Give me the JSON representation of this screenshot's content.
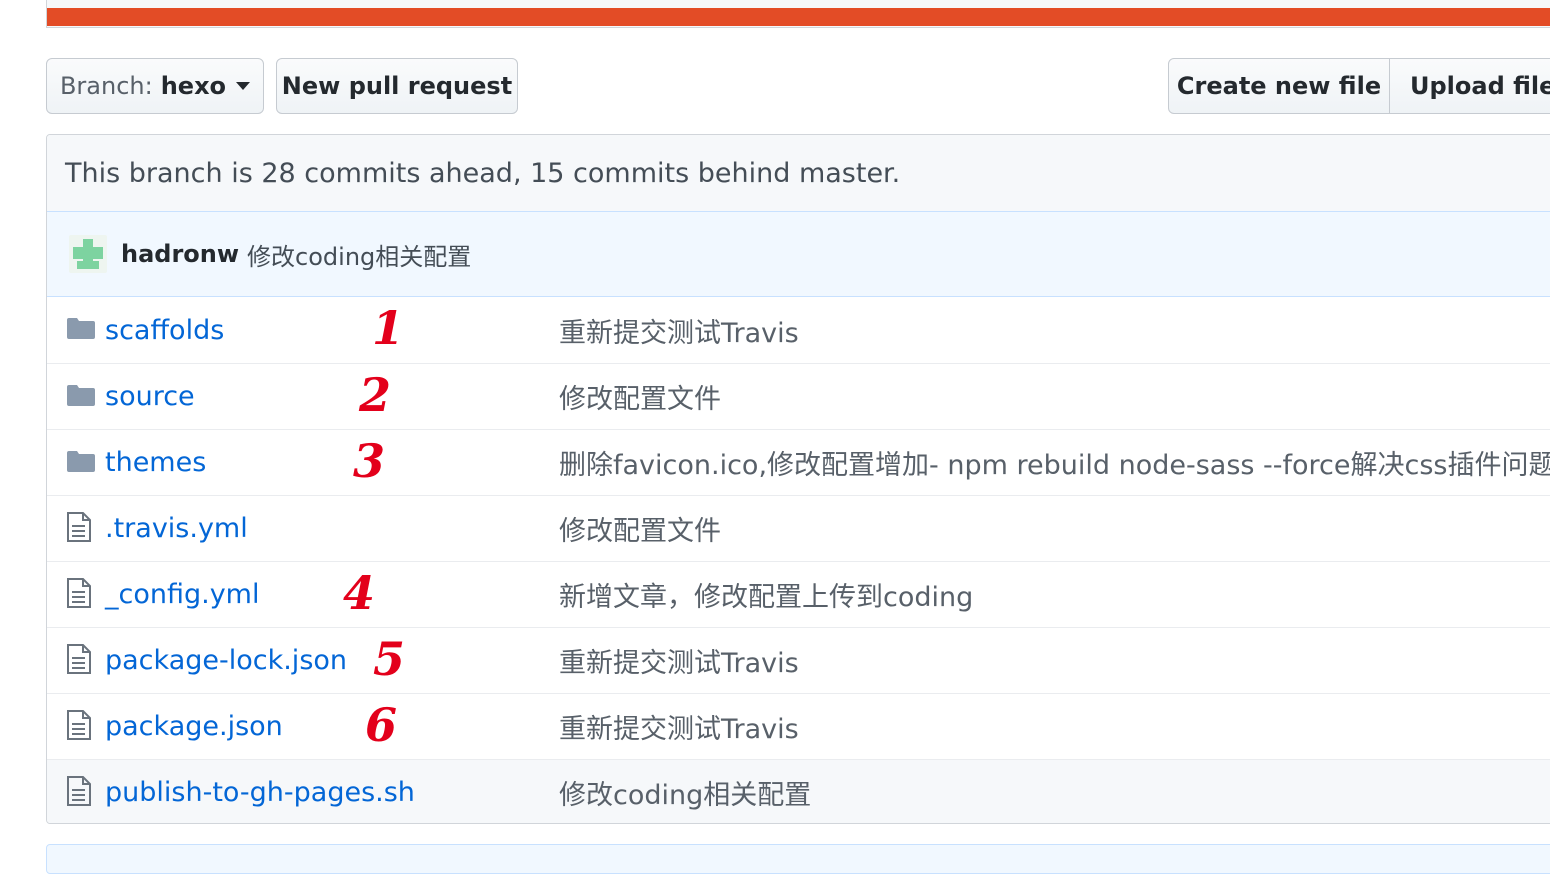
{
  "colors": {
    "language_bar": "#e34c26",
    "link": "#0366d6",
    "annotation": "#e3001b"
  },
  "toolbar": {
    "branch_label": "Branch:",
    "branch_name": "hexo",
    "new_pull_request": "New pull request",
    "create_new_file": "Create new file",
    "upload_files": "Upload files"
  },
  "branch_info": "This branch is 28 commits ahead, 15 commits behind master.",
  "latest_commit": {
    "author": "hadronw",
    "message": "修改coding相关配置"
  },
  "files": [
    {
      "name": "scaffolds",
      "type": "folder",
      "message": "重新提交测试Travis",
      "annotation": "1"
    },
    {
      "name": "source",
      "type": "folder",
      "message": "修改配置文件",
      "annotation": "2"
    },
    {
      "name": "themes",
      "type": "folder",
      "message": "删除favicon.ico,修改配置增加- npm rebuild node-sass --force解决css插件问题",
      "annotation": "3"
    },
    {
      "name": ".travis.yml",
      "type": "file",
      "message": "修改配置文件",
      "annotation": ""
    },
    {
      "name": "_config.yml",
      "type": "file",
      "message": "新增文章，修改配置上传到coding",
      "annotation": "4"
    },
    {
      "name": "package-lock.json",
      "type": "file",
      "message": "重新提交测试Travis",
      "annotation": "5"
    },
    {
      "name": "package.json",
      "type": "file",
      "message": "重新提交测试Travis",
      "annotation": "6"
    },
    {
      "name": "publish-to-gh-pages.sh",
      "type": "file",
      "message": "修改coding相关配置",
      "annotation": ""
    }
  ]
}
